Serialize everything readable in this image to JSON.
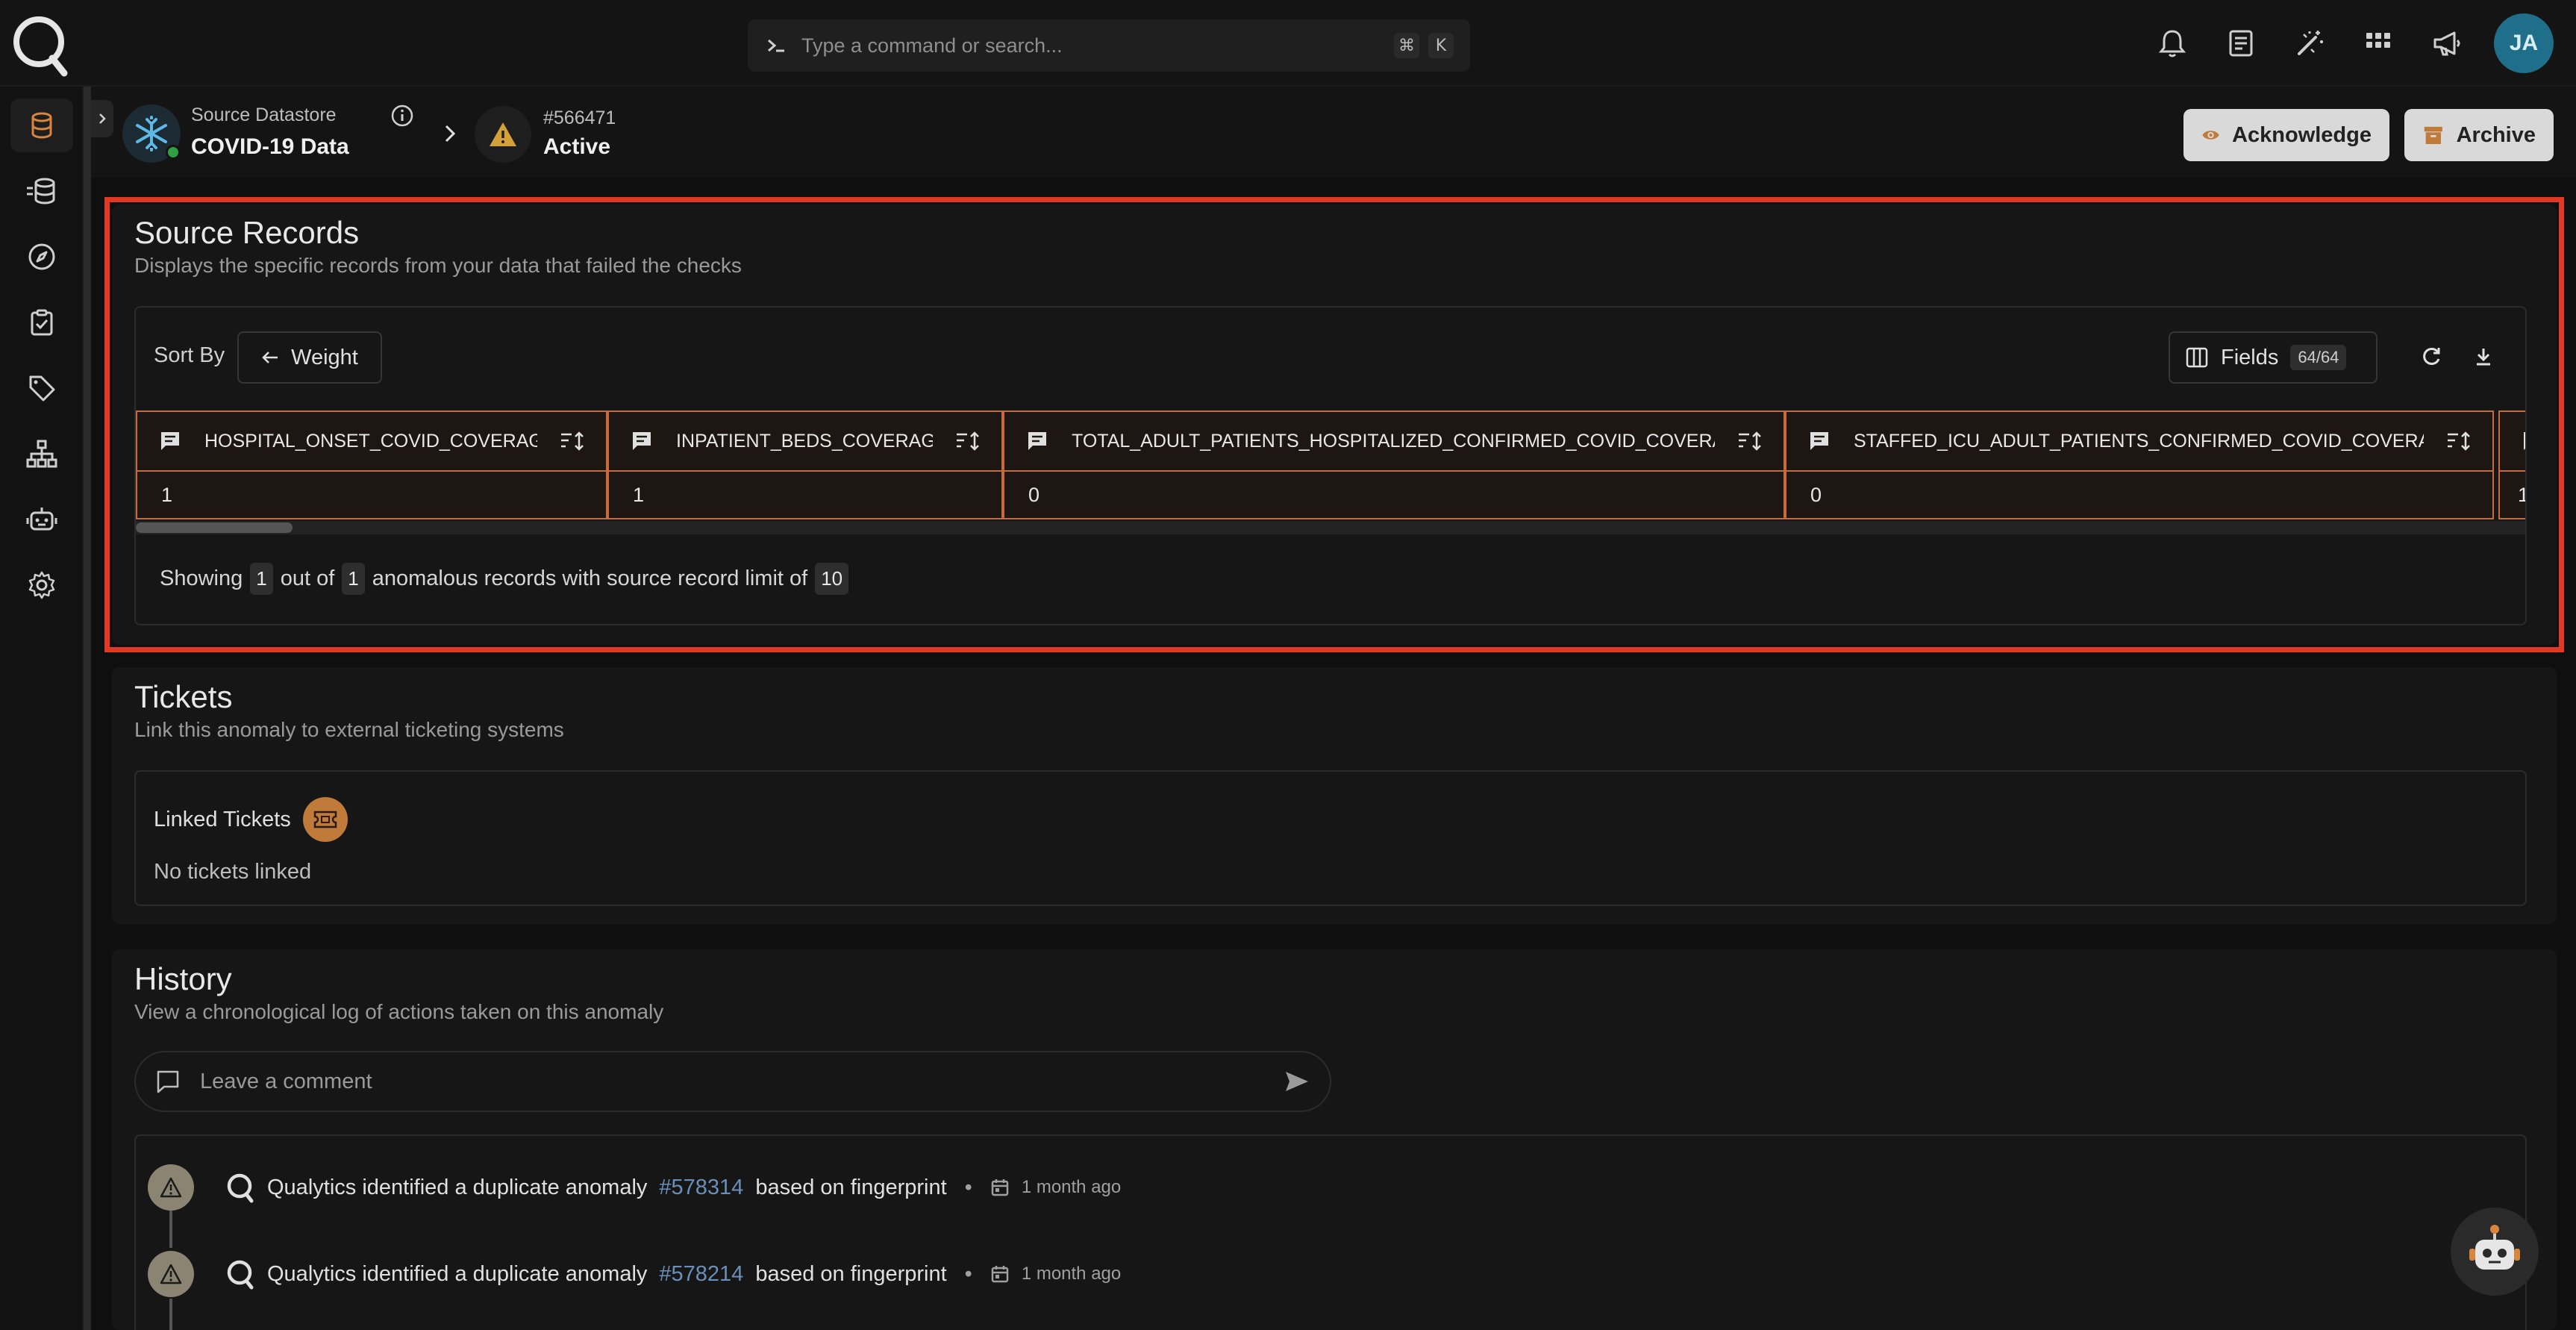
{
  "app": {
    "search_placeholder": "Type a command or search...",
    "shortcut_keys": [
      "⌘",
      "K"
    ],
    "user_initials": "JA",
    "accent_color": "#c47a3a",
    "highlight_color": "#e03a27"
  },
  "top_icons": [
    "bell-icon",
    "document-icon",
    "magic-wand-icon",
    "apps-grid-icon",
    "megaphone-icon"
  ],
  "sidebar": {
    "items": [
      "database-icon",
      "datastores-stack-icon",
      "compass-icon",
      "clipboard-check-icon",
      "tag-icon",
      "hierarchy-icon",
      "robot-icon",
      "gear-icon"
    ],
    "active_index": 0
  },
  "breadcrumb": {
    "datastore_label": "Source Datastore",
    "datastore_name": "COVID-19 Data",
    "anomaly_id": "#566471",
    "anomaly_status": "Active"
  },
  "actions": {
    "acknowledge": "Acknowledge",
    "archive": "Archive"
  },
  "source_records": {
    "title": "Source Records",
    "subtitle": "Displays the specific records from your data that failed the checks",
    "sort_by_label": "Sort By",
    "sort_value": "Weight",
    "fields_label": "Fields",
    "fields_count": "64/64",
    "columns": [
      {
        "name": "HOSPITAL_ONSET_COVID_COVERAGE",
        "value": "1"
      },
      {
        "name": "INPATIENT_BEDS_COVERAGE",
        "value": "1"
      },
      {
        "name": "TOTAL_ADULT_PATIENTS_HOSPITALIZED_CONFIRMED_COVID_COVERAGE",
        "value": "0"
      },
      {
        "name": "STAFFED_ICU_ADULT_PATIENTS_CONFIRMED_COVID_COVERAGE",
        "value": "0"
      },
      {
        "name": "",
        "value": "1"
      }
    ],
    "showing": {
      "prefix": "Showing",
      "count": "1",
      "out_of": "out of",
      "total": "1",
      "middle": "anomalous records with source record limit of",
      "limit": "10"
    }
  },
  "tickets": {
    "title": "Tickets",
    "subtitle": "Link this anomaly to external ticketing systems",
    "linked_label": "Linked Tickets",
    "empty_text": "No tickets linked"
  },
  "history": {
    "title": "History",
    "subtitle": "View a chronological log of actions taken on this anomaly",
    "comment_placeholder": "Leave a comment",
    "events": [
      {
        "text": "Qualytics identified a duplicate anomaly",
        "link": "#578314",
        "suffix": "based on fingerprint",
        "dot": "•",
        "time": "1 month ago"
      },
      {
        "text": "Qualytics identified a duplicate anomaly",
        "link": "#578214",
        "suffix": "based on fingerprint",
        "dot": "•",
        "time": "1 month ago"
      }
    ]
  }
}
